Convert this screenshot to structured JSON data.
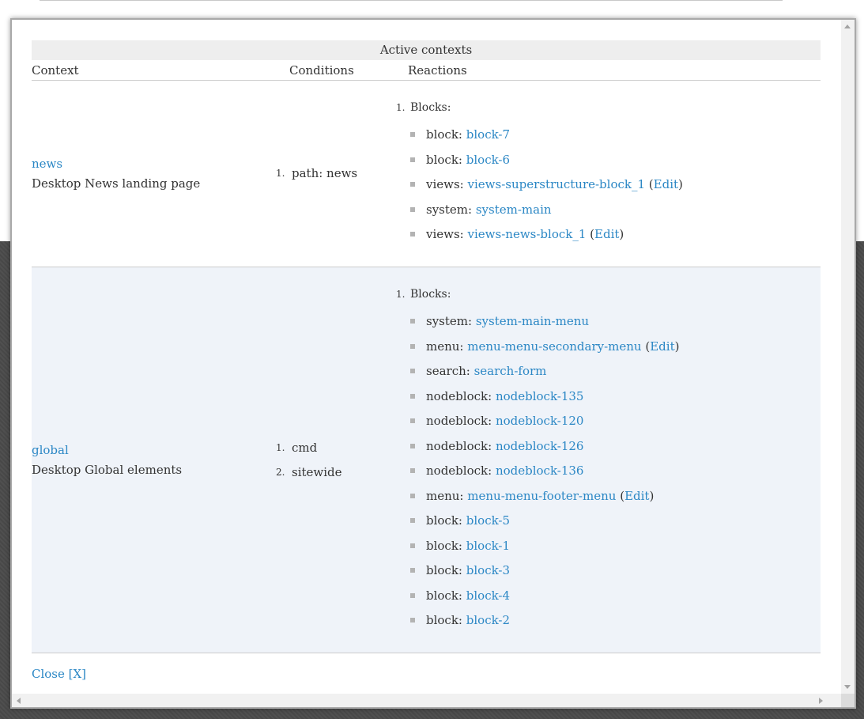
{
  "table": {
    "caption": "Active contexts",
    "headers": {
      "context": "Context",
      "conditions": "Conditions",
      "reactions": "Reactions"
    }
  },
  "contexts": [
    {
      "name": "news",
      "description": "Desktop News landing page",
      "conditions": [
        {
          "num": "1.",
          "label": "path: news"
        }
      ],
      "reaction_num": "1.",
      "reaction_title": "Blocks:",
      "blocks": [
        {
          "type": "block:",
          "link": "block-7"
        },
        {
          "type": "block:",
          "link": "block-6"
        },
        {
          "type": "views:",
          "link": "views-superstructure-block_1",
          "edit": "Edit"
        },
        {
          "type": "system:",
          "link": "system-main"
        },
        {
          "type": "views:",
          "link": "views-news-block_1",
          "edit": "Edit"
        }
      ]
    },
    {
      "name": "global",
      "description": "Desktop Global elements",
      "conditions": [
        {
          "num": "1.",
          "label": "cmd"
        },
        {
          "num": "2.",
          "label": "sitewide"
        }
      ],
      "reaction_num": "1.",
      "reaction_title": "Blocks:",
      "blocks": [
        {
          "type": "system:",
          "link": "system-main-menu"
        },
        {
          "type": "menu:",
          "link": "menu-menu-secondary-menu",
          "edit": "Edit"
        },
        {
          "type": "search:",
          "link": "search-form"
        },
        {
          "type": "nodeblock:",
          "link": "nodeblock-135"
        },
        {
          "type": "nodeblock:",
          "link": "nodeblock-120"
        },
        {
          "type": "nodeblock:",
          "link": "nodeblock-126"
        },
        {
          "type": "nodeblock:",
          "link": "nodeblock-136"
        },
        {
          "type": "menu:",
          "link": "menu-menu-footer-menu",
          "edit": "Edit"
        },
        {
          "type": "block:",
          "link": "block-5"
        },
        {
          "type": "block:",
          "link": "block-1"
        },
        {
          "type": "block:",
          "link": "block-3"
        },
        {
          "type": "block:",
          "link": "block-4"
        },
        {
          "type": "block:",
          "link": "block-2"
        }
      ]
    }
  ],
  "close_label": "Close [X]",
  "colors": {
    "link": "#2b87c5",
    "header_bg": "#eeeeee",
    "alt_row_bg": "#eff3f9",
    "text": "#333333"
  }
}
